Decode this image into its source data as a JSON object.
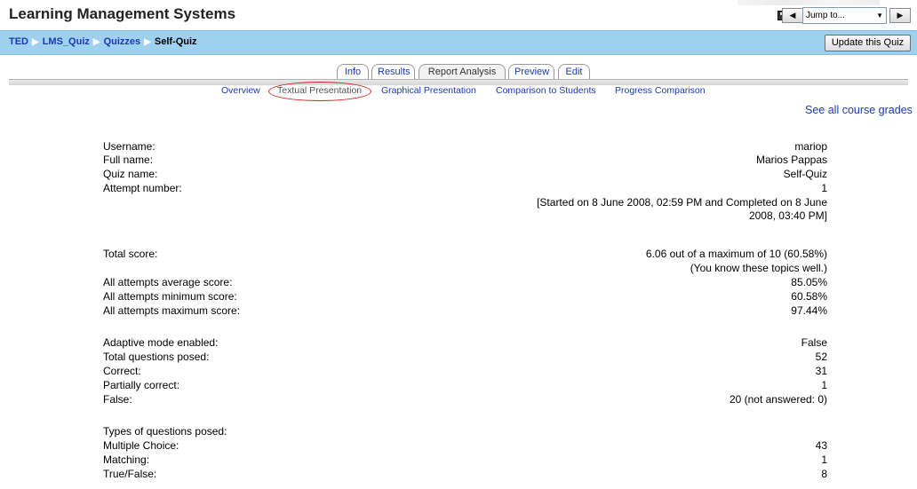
{
  "header": {
    "title": "Learning Management Systems",
    "jump_label": "Jump to...",
    "prev_glyph": "◀",
    "next_glyph": "▶"
  },
  "navbar": {
    "breadcrumb": [
      "TED",
      "LMS_Quiz",
      "Quizzes",
      "Self-Quiz"
    ],
    "update_button": "Update this Quiz"
  },
  "tabs": [
    "Info",
    "Results",
    "Report Analysis",
    "Preview",
    "Edit"
  ],
  "active_tab": "Report Analysis",
  "subtabs": [
    "Overview",
    "Textual Presentation",
    "Graphical Presentation",
    "Comparison to Students",
    "Progress Comparison"
  ],
  "active_subtab": "Textual Presentation",
  "grades_link": "See all course grades",
  "report": {
    "username": {
      "label": "Username:",
      "value": "mariop"
    },
    "fullname": {
      "label": "Full name:",
      "value": "Marios Pappas"
    },
    "quizname": {
      "label": "Quiz name:",
      "value": "Self-Quiz"
    },
    "attempt": {
      "label": "Attempt number:",
      "value": "1"
    },
    "attempt_detail": "[Started on 8 June 2008, 02:59 PM and Completed on 8 June 2008, 03:40 PM]",
    "total_score": {
      "label": "Total score:",
      "value": "6.06 out of a maximum of 10 (60.58%)"
    },
    "score_comment": "(You know these topics well.)",
    "avg": {
      "label": "All attempts average score:",
      "value": "85.05%"
    },
    "min": {
      "label": "All attempts minimum score:",
      "value": "60.58%"
    },
    "max": {
      "label": "All attempts maximum score:",
      "value": "97.44%"
    },
    "adaptive": {
      "label": "Adaptive mode enabled:",
      "value": "False"
    },
    "posed": {
      "label": "Total questions posed:",
      "value": "52"
    },
    "correct": {
      "label": "Correct:",
      "value": "31"
    },
    "partial": {
      "label": "Partially correct:",
      "value": "1"
    },
    "false": {
      "label": "False:",
      "value": "20 (not answered: 0)"
    },
    "types_heading": "Types of questions posed:",
    "multiple": {
      "label": "Multiple Choice:",
      "value": "43"
    },
    "matching": {
      "label": "Matching:",
      "value": "1"
    },
    "truefalse": {
      "label": "True/False:",
      "value": "8"
    }
  },
  "colors": {
    "navbar": "#9fd1ee",
    "link": "#1a39b2",
    "highlight_circle": "#d42020"
  }
}
